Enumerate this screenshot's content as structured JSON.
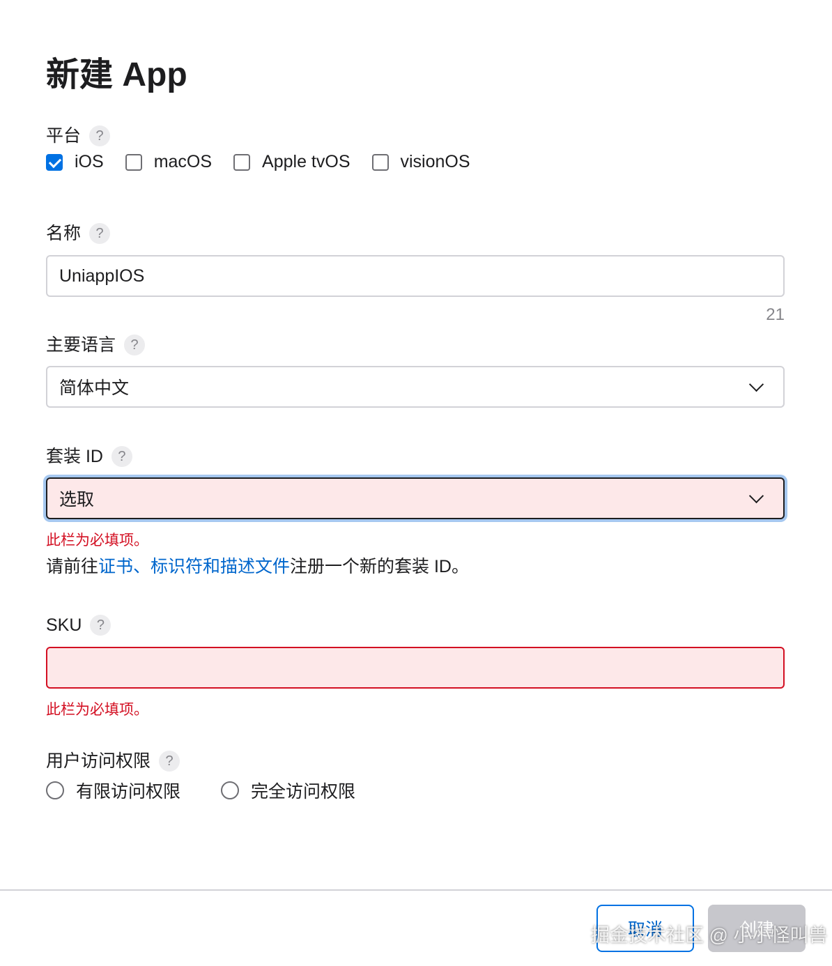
{
  "title": "新建 App",
  "platform": {
    "label": "平台",
    "help": "?",
    "options": [
      {
        "label": "iOS",
        "checked": true
      },
      {
        "label": "macOS",
        "checked": false
      },
      {
        "label": "Apple tvOS",
        "checked": false
      },
      {
        "label": "visionOS",
        "checked": false
      }
    ]
  },
  "name": {
    "label": "名称",
    "help": "?",
    "value": "UniappIOS",
    "counter": "21"
  },
  "language": {
    "label": "主要语言",
    "help": "?",
    "value": "简体中文"
  },
  "bundle_id": {
    "label": "套装 ID",
    "help": "?",
    "value": "选取",
    "error": "此栏为必填项。",
    "info_prefix": "请前往",
    "info_link": "证书、标识符和描述文件",
    "info_suffix": "注册一个新的套装 ID。"
  },
  "sku": {
    "label": "SKU",
    "help": "?",
    "value": "",
    "error": "此栏为必填项。"
  },
  "user_access": {
    "label": "用户访问权限",
    "help": "?",
    "options": [
      {
        "label": "有限访问权限",
        "selected": false
      },
      {
        "label": "完全访问权限",
        "selected": false
      }
    ]
  },
  "footer": {
    "cancel_label": "取消",
    "create_label": "创建"
  },
  "watermark": "掘金技术社区 @ 小小怪叫兽",
  "colors": {
    "accent": "#0071e3",
    "link": "#0066cc",
    "error": "#d30f22",
    "error_bg": "#fde8e9"
  }
}
